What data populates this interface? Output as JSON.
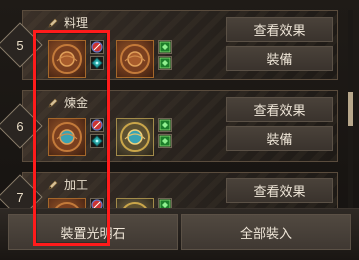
{
  "rows": [
    {
      "number": "5",
      "category": "料理",
      "buttons": [
        "查看效果",
        "裝備"
      ]
    },
    {
      "number": "6",
      "category": "煉金",
      "buttons": [
        "查看效果",
        "裝備"
      ]
    },
    {
      "number": "7",
      "category": "加工",
      "buttons": [
        "查看效果"
      ]
    }
  ],
  "bottom": {
    "left_button": "裝置光明石",
    "right_button": "全部裝入"
  },
  "colors": {
    "highlight": "#ff1b1b",
    "panel_border": "#5a4c3d",
    "button_bg": "#3a332d"
  },
  "icons": {
    "category": "pencil-icon",
    "slot_bronze": "bronze-medallion-icon",
    "slot_gold": "gold-medallion-icon",
    "mini_red": "red-stone-icon",
    "mini_blue": "blue-stone-icon",
    "mini_green": "green-stone-icon"
  }
}
